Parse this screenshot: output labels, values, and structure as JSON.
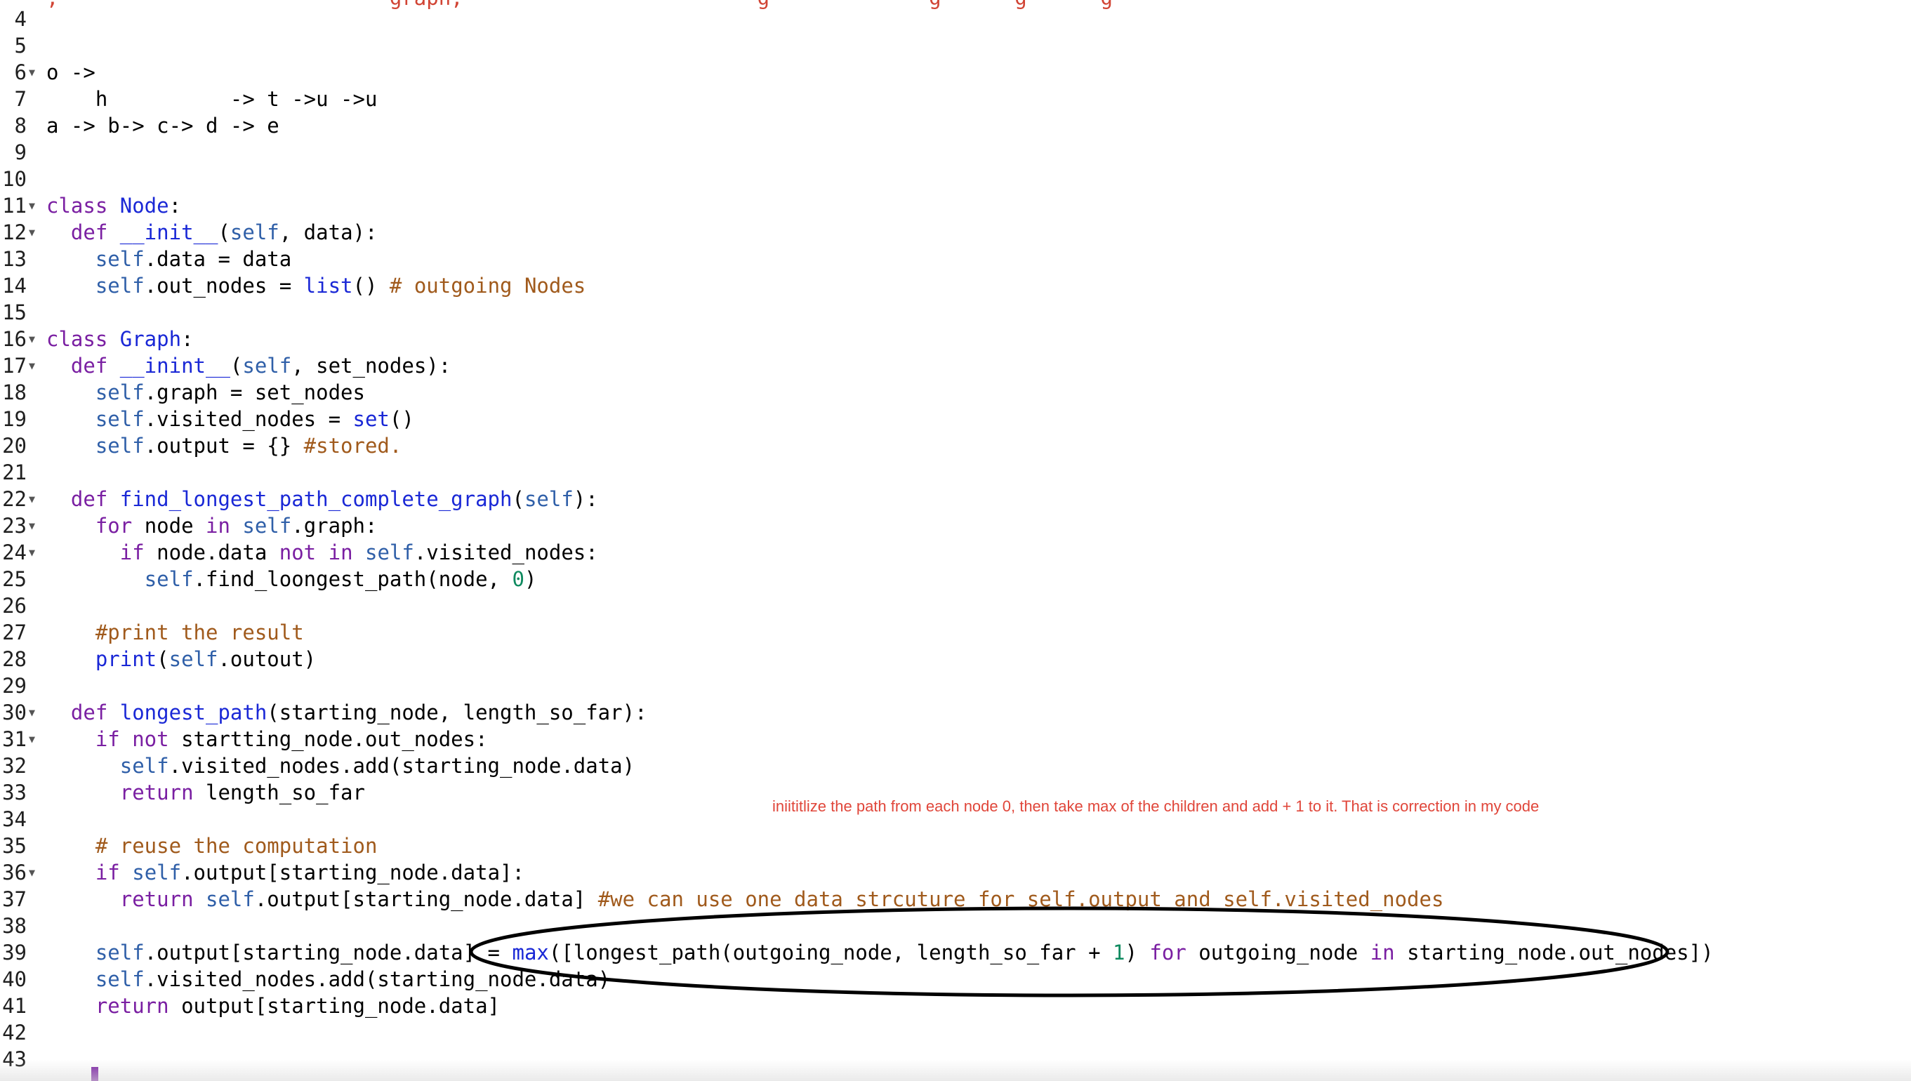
{
  "editor": {
    "top_fragment": ",                           graph,                        g             g      g      g   ",
    "annotation": "iniititlize the path from each node 0, then take max of the children and add + 1 to it. That is correction in my code",
    "lines": [
      {
        "n": "4",
        "fold": false,
        "tokens": []
      },
      {
        "n": "5",
        "fold": false,
        "tokens": []
      },
      {
        "n": "6",
        "fold": true,
        "tokens": [
          {
            "t": "o ->",
            "c": ""
          }
        ]
      },
      {
        "n": "7",
        "fold": false,
        "tokens": [
          {
            "t": "    h          -> t ->u ->u",
            "c": ""
          }
        ]
      },
      {
        "n": "8",
        "fold": false,
        "tokens": [
          {
            "t": "a -> b-> c-> d -> e",
            "c": ""
          }
        ]
      },
      {
        "n": "9",
        "fold": false,
        "tokens": []
      },
      {
        "n": "10",
        "fold": false,
        "tokens": []
      },
      {
        "n": "11",
        "fold": true,
        "tokens": [
          {
            "t": "class ",
            "c": "kw"
          },
          {
            "t": "Node",
            "c": "fn"
          },
          {
            "t": ":",
            "c": ""
          }
        ]
      },
      {
        "n": "12",
        "fold": true,
        "tokens": [
          {
            "t": "  ",
            "c": ""
          },
          {
            "t": "def ",
            "c": "kw"
          },
          {
            "t": "__init__",
            "c": "fn"
          },
          {
            "t": "(",
            "c": ""
          },
          {
            "t": "self",
            "c": "self"
          },
          {
            "t": ", data):",
            "c": ""
          }
        ]
      },
      {
        "n": "13",
        "fold": false,
        "tokens": [
          {
            "t": "    ",
            "c": ""
          },
          {
            "t": "self",
            "c": "self"
          },
          {
            "t": ".data = data",
            "c": ""
          }
        ]
      },
      {
        "n": "14",
        "fold": false,
        "tokens": [
          {
            "t": "    ",
            "c": ""
          },
          {
            "t": "self",
            "c": "self"
          },
          {
            "t": ".out_nodes = ",
            "c": ""
          },
          {
            "t": "list",
            "c": "fn"
          },
          {
            "t": "() ",
            "c": ""
          },
          {
            "t": "# outgoing Nodes",
            "c": "cm"
          }
        ]
      },
      {
        "n": "15",
        "fold": false,
        "tokens": []
      },
      {
        "n": "16",
        "fold": true,
        "tokens": [
          {
            "t": "class ",
            "c": "kw"
          },
          {
            "t": "Graph",
            "c": "fn"
          },
          {
            "t": ":",
            "c": ""
          }
        ]
      },
      {
        "n": "17",
        "fold": true,
        "tokens": [
          {
            "t": "  ",
            "c": ""
          },
          {
            "t": "def ",
            "c": "kw"
          },
          {
            "t": "__inint__",
            "c": "fn"
          },
          {
            "t": "(",
            "c": ""
          },
          {
            "t": "self",
            "c": "self"
          },
          {
            "t": ", set_nodes):",
            "c": ""
          }
        ]
      },
      {
        "n": "18",
        "fold": false,
        "tokens": [
          {
            "t": "    ",
            "c": ""
          },
          {
            "t": "self",
            "c": "self"
          },
          {
            "t": ".graph = set_nodes",
            "c": ""
          }
        ]
      },
      {
        "n": "19",
        "fold": false,
        "tokens": [
          {
            "t": "    ",
            "c": ""
          },
          {
            "t": "self",
            "c": "self"
          },
          {
            "t": ".visited_nodes = ",
            "c": ""
          },
          {
            "t": "set",
            "c": "fn"
          },
          {
            "t": "()",
            "c": ""
          }
        ]
      },
      {
        "n": "20",
        "fold": false,
        "tokens": [
          {
            "t": "    ",
            "c": ""
          },
          {
            "t": "self",
            "c": "self"
          },
          {
            "t": ".output = {} ",
            "c": ""
          },
          {
            "t": "#stored.",
            "c": "cm"
          }
        ]
      },
      {
        "n": "21",
        "fold": false,
        "tokens": []
      },
      {
        "n": "22",
        "fold": true,
        "tokens": [
          {
            "t": "  ",
            "c": ""
          },
          {
            "t": "def ",
            "c": "kw"
          },
          {
            "t": "find_longest_path_complete_graph",
            "c": "fn"
          },
          {
            "t": "(",
            "c": ""
          },
          {
            "t": "self",
            "c": "self"
          },
          {
            "t": "):",
            "c": ""
          }
        ]
      },
      {
        "n": "23",
        "fold": true,
        "tokens": [
          {
            "t": "    ",
            "c": ""
          },
          {
            "t": "for ",
            "c": "kw"
          },
          {
            "t": "node ",
            "c": ""
          },
          {
            "t": "in ",
            "c": "kw"
          },
          {
            "t": "self",
            "c": "self"
          },
          {
            "t": ".graph:",
            "c": ""
          }
        ]
      },
      {
        "n": "24",
        "fold": true,
        "tokens": [
          {
            "t": "      ",
            "c": ""
          },
          {
            "t": "if ",
            "c": "kw"
          },
          {
            "t": "node.data ",
            "c": ""
          },
          {
            "t": "not in ",
            "c": "kw"
          },
          {
            "t": "self",
            "c": "self"
          },
          {
            "t": ".visited_nodes:",
            "c": ""
          }
        ]
      },
      {
        "n": "25",
        "fold": false,
        "tokens": [
          {
            "t": "        ",
            "c": ""
          },
          {
            "t": "self",
            "c": "self"
          },
          {
            "t": ".find_loongest_path(node, ",
            "c": ""
          },
          {
            "t": "0",
            "c": "num"
          },
          {
            "t": ")",
            "c": ""
          }
        ]
      },
      {
        "n": "26",
        "fold": false,
        "tokens": []
      },
      {
        "n": "27",
        "fold": false,
        "tokens": [
          {
            "t": "    ",
            "c": ""
          },
          {
            "t": "#print the result",
            "c": "cm"
          }
        ]
      },
      {
        "n": "28",
        "fold": false,
        "tokens": [
          {
            "t": "    ",
            "c": ""
          },
          {
            "t": "print",
            "c": "fn"
          },
          {
            "t": "(",
            "c": ""
          },
          {
            "t": "self",
            "c": "self"
          },
          {
            "t": ".outout)",
            "c": ""
          }
        ]
      },
      {
        "n": "29",
        "fold": false,
        "tokens": []
      },
      {
        "n": "30",
        "fold": true,
        "tokens": [
          {
            "t": "  ",
            "c": ""
          },
          {
            "t": "def ",
            "c": "kw"
          },
          {
            "t": "longest_path",
            "c": "fn"
          },
          {
            "t": "(starting_node, length_so_far):",
            "c": ""
          }
        ]
      },
      {
        "n": "31",
        "fold": true,
        "tokens": [
          {
            "t": "    ",
            "c": ""
          },
          {
            "t": "if not ",
            "c": "kw"
          },
          {
            "t": "startting_node.out_nodes:",
            "c": ""
          }
        ]
      },
      {
        "n": "32",
        "fold": false,
        "tokens": [
          {
            "t": "      ",
            "c": ""
          },
          {
            "t": "self",
            "c": "self"
          },
          {
            "t": ".visited_nodes.add(starting_node.data)",
            "c": ""
          }
        ]
      },
      {
        "n": "33",
        "fold": false,
        "tokens": [
          {
            "t": "      ",
            "c": ""
          },
          {
            "t": "return ",
            "c": "kw"
          },
          {
            "t": "length_so_far",
            "c": ""
          }
        ]
      },
      {
        "n": "34",
        "fold": false,
        "tokens": []
      },
      {
        "n": "35",
        "fold": false,
        "tokens": [
          {
            "t": "    ",
            "c": ""
          },
          {
            "t": "# reuse the computation",
            "c": "cm"
          }
        ]
      },
      {
        "n": "36",
        "fold": true,
        "tokens": [
          {
            "t": "    ",
            "c": ""
          },
          {
            "t": "if ",
            "c": "kw"
          },
          {
            "t": "self",
            "c": "self"
          },
          {
            "t": ".output[starting_node.data]:",
            "c": ""
          }
        ]
      },
      {
        "n": "37",
        "fold": false,
        "tokens": [
          {
            "t": "      ",
            "c": ""
          },
          {
            "t": "return ",
            "c": "kw"
          },
          {
            "t": "self",
            "c": "self"
          },
          {
            "t": ".output[starting_node.data] ",
            "c": ""
          },
          {
            "t": "#we can use one data strcuture for self.output and self.visited_nodes",
            "c": "cm"
          }
        ]
      },
      {
        "n": "38",
        "fold": false,
        "tokens": []
      },
      {
        "n": "39",
        "fold": false,
        "tokens": [
          {
            "t": "    ",
            "c": ""
          },
          {
            "t": "self",
            "c": "self"
          },
          {
            "t": ".output[starting_node.data] = ",
            "c": ""
          },
          {
            "t": "max",
            "c": "fn"
          },
          {
            "t": "([longest_path(outgoing_node, length_so_far + ",
            "c": ""
          },
          {
            "t": "1",
            "c": "num"
          },
          {
            "t": ") ",
            "c": ""
          },
          {
            "t": "for ",
            "c": "kw"
          },
          {
            "t": "outgoing_node ",
            "c": ""
          },
          {
            "t": "in ",
            "c": "kw"
          },
          {
            "t": "starting_node.out_nodes])",
            "c": ""
          }
        ]
      },
      {
        "n": "40",
        "fold": false,
        "tokens": [
          {
            "t": "    ",
            "c": ""
          },
          {
            "t": "self",
            "c": "self"
          },
          {
            "t": ".visited_nodes.add(starting_node.data)",
            "c": ""
          }
        ]
      },
      {
        "n": "41",
        "fold": false,
        "tokens": [
          {
            "t": "    ",
            "c": ""
          },
          {
            "t": "return ",
            "c": "kw"
          },
          {
            "t": "output[starting_node.data]",
            "c": ""
          }
        ]
      },
      {
        "n": "42",
        "fold": false,
        "tokens": []
      },
      {
        "n": "43",
        "fold": false,
        "tokens": []
      }
    ]
  }
}
